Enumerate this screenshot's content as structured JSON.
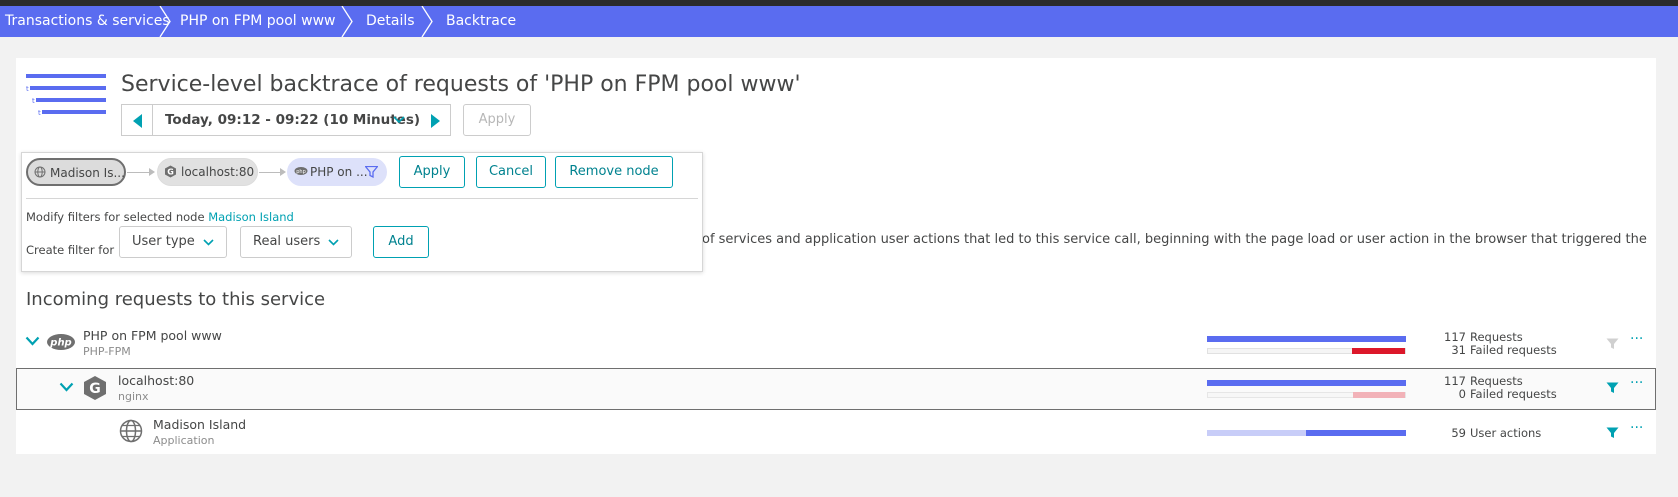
{
  "breadcrumb": {
    "items": [
      "Transactions & services",
      "PHP on FPM pool www",
      "Details",
      "Backtrace"
    ]
  },
  "page": {
    "title": "Service-level backtrace of requests of 'PHP on FPM pool www'",
    "timeframe": {
      "label": "Today, 09:12 - 09:22 (10 Minutes)",
      "apply_label": "Apply"
    },
    "description_fragment": "of services and application user actions that led to this service call, beginning with the page load or user action in the browser that triggered the"
  },
  "filter_popup": {
    "nodes": [
      "Madison Is...",
      "localhost:80",
      "PHP on ..."
    ],
    "apply_label": "Apply",
    "cancel_label": "Cancel",
    "remove_label": "Remove node",
    "modify_prefix": "Modify filters for selected node",
    "modify_node": "Madison Island",
    "create_label": "Create filter for",
    "filter_type": "User type",
    "filter_value": "Real users",
    "add_label": "Add"
  },
  "section": {
    "heading": "Incoming requests to this service"
  },
  "rows": [
    {
      "name": "PHP on FPM pool www",
      "sub": "PHP-FPM",
      "icon": "php-icon",
      "primary_count": "117",
      "primary_label": "Requests",
      "secondary_count": "31",
      "secondary_label": "Failed requests",
      "failed_fraction": 0.265
    },
    {
      "name": "localhost:80",
      "sub": "nginx",
      "icon": "nginx-icon",
      "primary_count": "117",
      "primary_label": "Requests",
      "secondary_count": "0",
      "secondary_label": "Failed requests",
      "failed_fraction": 0
    },
    {
      "name": "Madison Island",
      "sub": "Application",
      "icon": "globe-icon",
      "primary_count": "59",
      "primary_label": "User actions",
      "user_action_fraction": 0.5
    }
  ],
  "colors": {
    "brand_blue": "#5a6cf0",
    "accent_teal": "#00a1b2",
    "failed_red": "#dc172a",
    "failed_red_light": "#f2b2b8",
    "light_blue": "#c8cdf8"
  }
}
